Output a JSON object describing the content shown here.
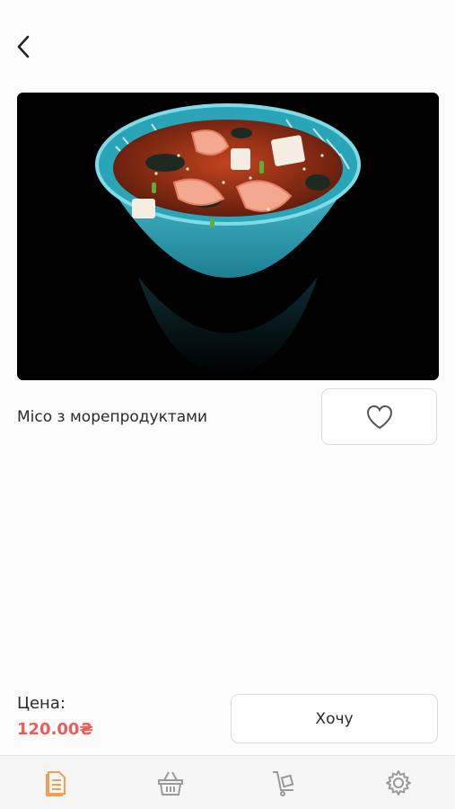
{
  "product": {
    "title": "Місо з морепродуктами",
    "image_icon": "miso-soup-bowl-image"
  },
  "price": {
    "label": "Цена:",
    "value": "120.00₴"
  },
  "actions": {
    "want_label": "Хочу"
  },
  "tabbar": {
    "items": [
      {
        "icon": "menu-icon",
        "active": true
      },
      {
        "icon": "basket-icon",
        "active": false
      },
      {
        "icon": "delivery-icon",
        "active": false
      },
      {
        "icon": "settings-icon",
        "active": false
      }
    ]
  },
  "colors": {
    "accent": "#f0a052",
    "price": "#ec5c5c",
    "icon_inactive": "#9a9a9a"
  }
}
